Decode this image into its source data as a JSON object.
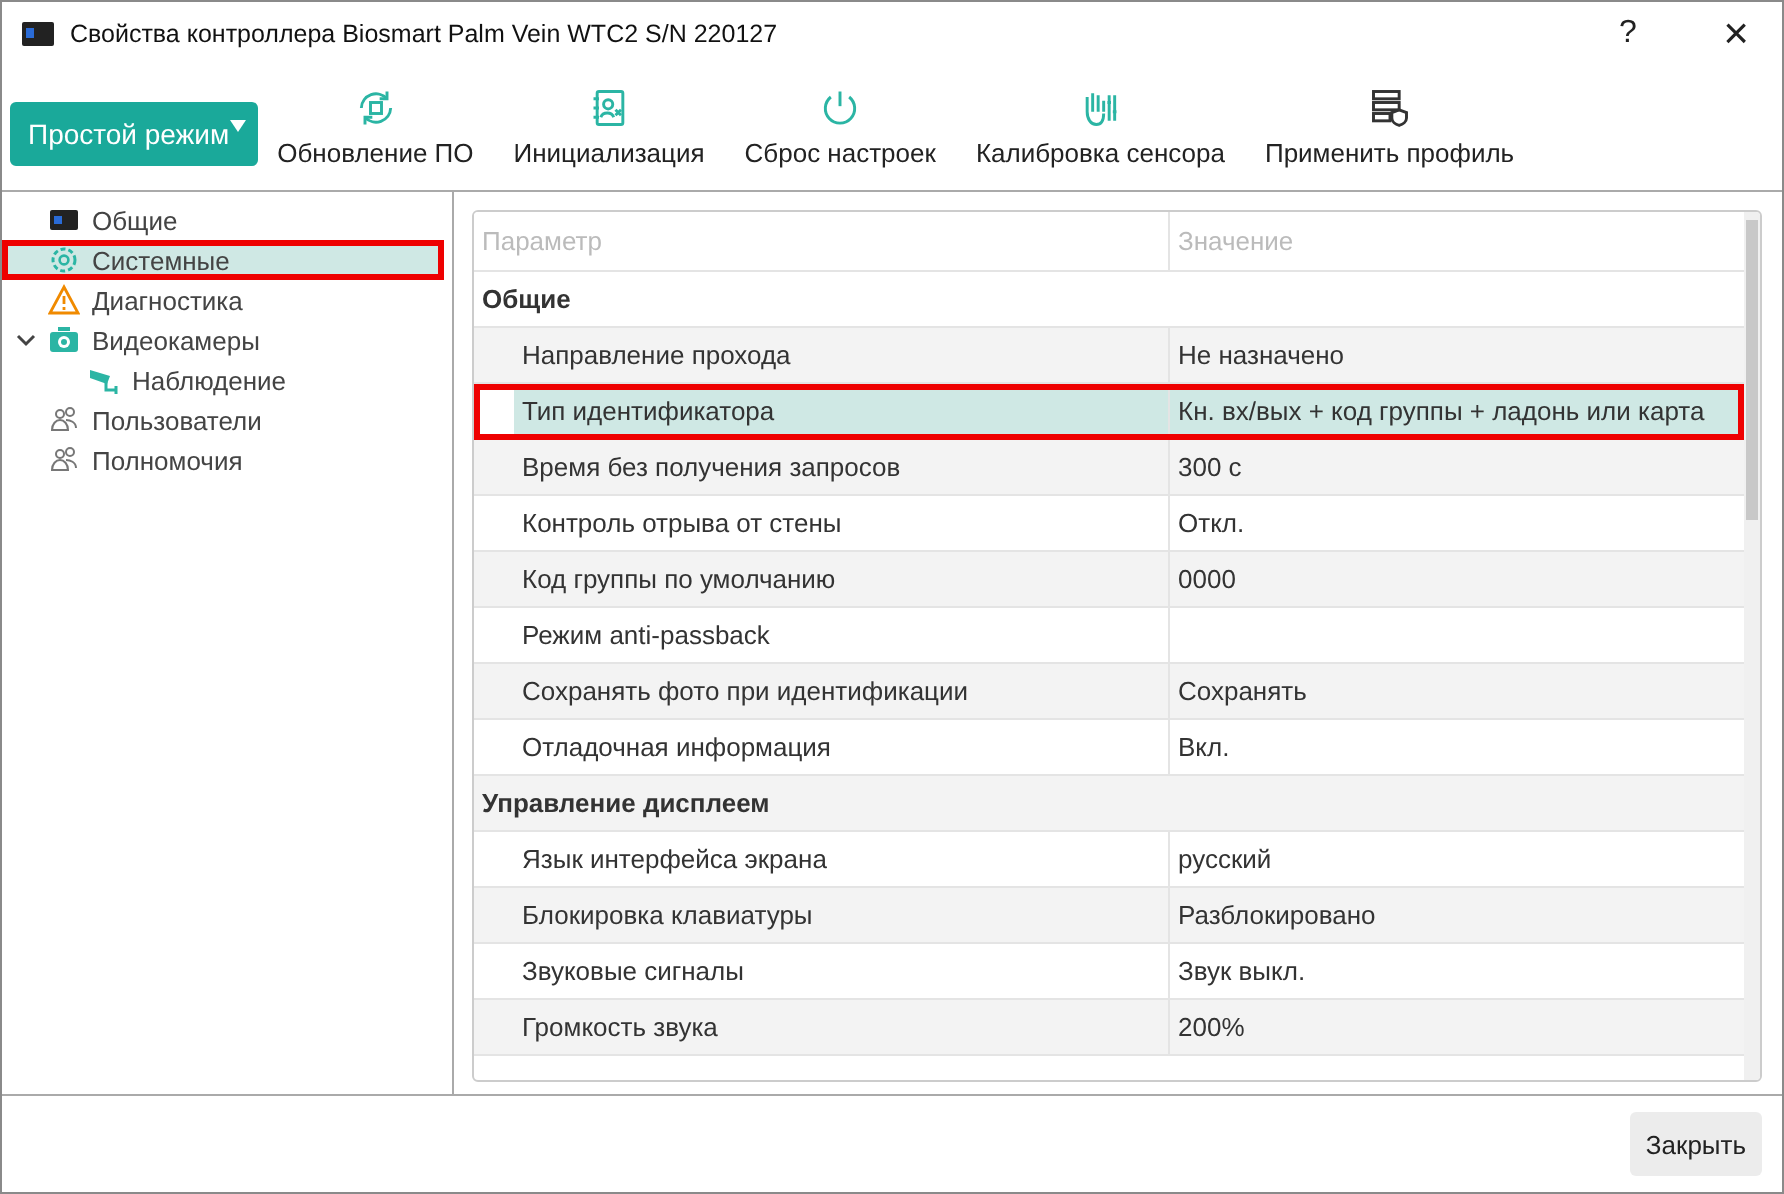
{
  "window": {
    "title": "Свойства контроллера Biosmart Palm Vein WTC2 S/N 220127",
    "help": "?",
    "close": "×"
  },
  "toolbar": {
    "mode_button": "Простой режим",
    "actions": [
      {
        "label": "Обновление ПО",
        "kind": "refresh"
      },
      {
        "label": "Инициализация",
        "kind": "init"
      },
      {
        "label": "Сброс настроек",
        "kind": "reset"
      },
      {
        "label": "Калибровка сенсора",
        "kind": "hand"
      },
      {
        "label": "Применить профиль",
        "kind": "profile"
      }
    ]
  },
  "sidebar": {
    "items": [
      {
        "label": "Общие",
        "kind": "device",
        "selected": false,
        "highlighted": false
      },
      {
        "label": "Системные",
        "kind": "gear",
        "selected": true,
        "highlighted": true
      },
      {
        "label": "Диагностика",
        "kind": "warning",
        "selected": false,
        "highlighted": false
      },
      {
        "label": "Видеокамеры",
        "kind": "camera",
        "selected": false,
        "highlighted": false,
        "expanded": true,
        "children": [
          {
            "label": "Наблюдение",
            "kind": "cctv",
            "selected": false,
            "highlighted": false
          }
        ]
      },
      {
        "label": "Пользователи",
        "kind": "users",
        "selected": false,
        "highlighted": false
      },
      {
        "label": "Полномочия",
        "kind": "users",
        "selected": false,
        "highlighted": false
      }
    ]
  },
  "table": {
    "columns": [
      "Параметр",
      "Значение"
    ],
    "rows": [
      {
        "kind": "section",
        "name": "Общие"
      },
      {
        "kind": "property",
        "name": "Направление прохода",
        "value": "Не назначено",
        "selected": false,
        "highlighted": false
      },
      {
        "kind": "property",
        "name": "Тип идентификатора",
        "value": "Кн. вх/вых + код группы + ладонь или карта",
        "selected": true,
        "highlighted": true
      },
      {
        "kind": "property",
        "name": "Время без получения запросов",
        "value": "300 с",
        "selected": false,
        "highlighted": false
      },
      {
        "kind": "property",
        "name": "Контроль отрыва от стены",
        "value": "Откл.",
        "selected": false,
        "highlighted": false
      },
      {
        "kind": "property",
        "name": "Код группы по умолчанию",
        "value": "0000",
        "selected": false,
        "highlighted": false
      },
      {
        "kind": "property",
        "name": "Режим anti-passback",
        "selected": false,
        "highlighted": false
      },
      {
        "kind": "property",
        "name": "Сохранять фото при идентификации",
        "value": "Сохранять",
        "selected": false,
        "highlighted": false
      },
      {
        "kind": "property",
        "name": "Отладочная информация",
        "value": "Вкл.",
        "selected": false,
        "highlighted": false
      },
      {
        "kind": "section",
        "name": "Управление дисплеем"
      },
      {
        "kind": "property",
        "name": "Язык интерфейса экрана",
        "value": "русский",
        "selected": false,
        "highlighted": false
      },
      {
        "kind": "property",
        "name": "Блокировка клавиатуры",
        "value": "Разблокировано",
        "selected": false,
        "highlighted": false
      },
      {
        "kind": "property",
        "name": "Звуковые сигналы",
        "value": "Звук выкл.",
        "selected": false,
        "highlighted": false
      },
      {
        "kind": "property",
        "name": "Громкость звука",
        "value": "200%",
        "selected": false,
        "highlighted": false
      }
    ]
  },
  "footer": {
    "close_button": "Закрыть"
  }
}
